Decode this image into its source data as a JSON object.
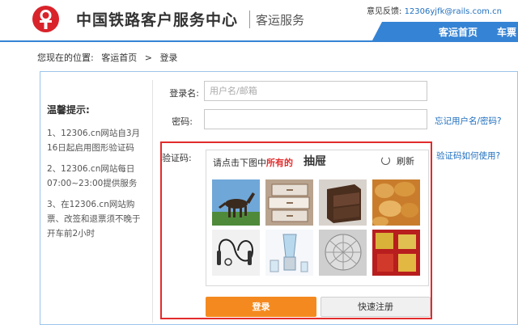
{
  "header": {
    "site_name": "中国铁路客户服务中心",
    "site_subtitle": "客运服务",
    "feedback_label": "意见反馈:",
    "feedback_email": "12306yjfk@rails.com.cn",
    "nav": {
      "home": "客运首页",
      "ticket": "车票"
    }
  },
  "breadcrumb": {
    "prefix": "您现在的位置:",
    "home": "客运首页",
    "separator": ">",
    "current": "登录"
  },
  "tips": {
    "title": "温馨提示:",
    "items": [
      "1、12306.cn网站自3月16日起启用图形验证码",
      "2、12306.cn网站每日07:00~23:00提供服务",
      "3、在12306.cn网站购票、改签和退票须不晚于开车前2小时"
    ]
  },
  "form": {
    "username_label": "登录名:",
    "username_placeholder": "用户名/邮箱",
    "username_value": "",
    "password_label": "密码:",
    "password_value": "",
    "forgot_link": "忘记用户名/密码?",
    "captcha_label": "验证码:",
    "captcha_help_link": "验证码如何使用?"
  },
  "captcha": {
    "prompt_before": "请点击下图中",
    "prompt_highlight": "所有的",
    "target_word": "抽屉",
    "refresh_label": "刷新",
    "tiles": [
      "horse",
      "drawers",
      "cabinet",
      "potatoes",
      "jump-rope",
      "blender",
      "wire-mesh",
      "red-wall"
    ]
  },
  "buttons": {
    "login": "登录",
    "register": "快速注册"
  },
  "colors": {
    "brand_red": "#d9232a",
    "nav_blue": "#3583d4",
    "link_blue": "#1f6fbf",
    "login_orange": "#f48a1f",
    "captcha_border": "#e32b2b"
  }
}
